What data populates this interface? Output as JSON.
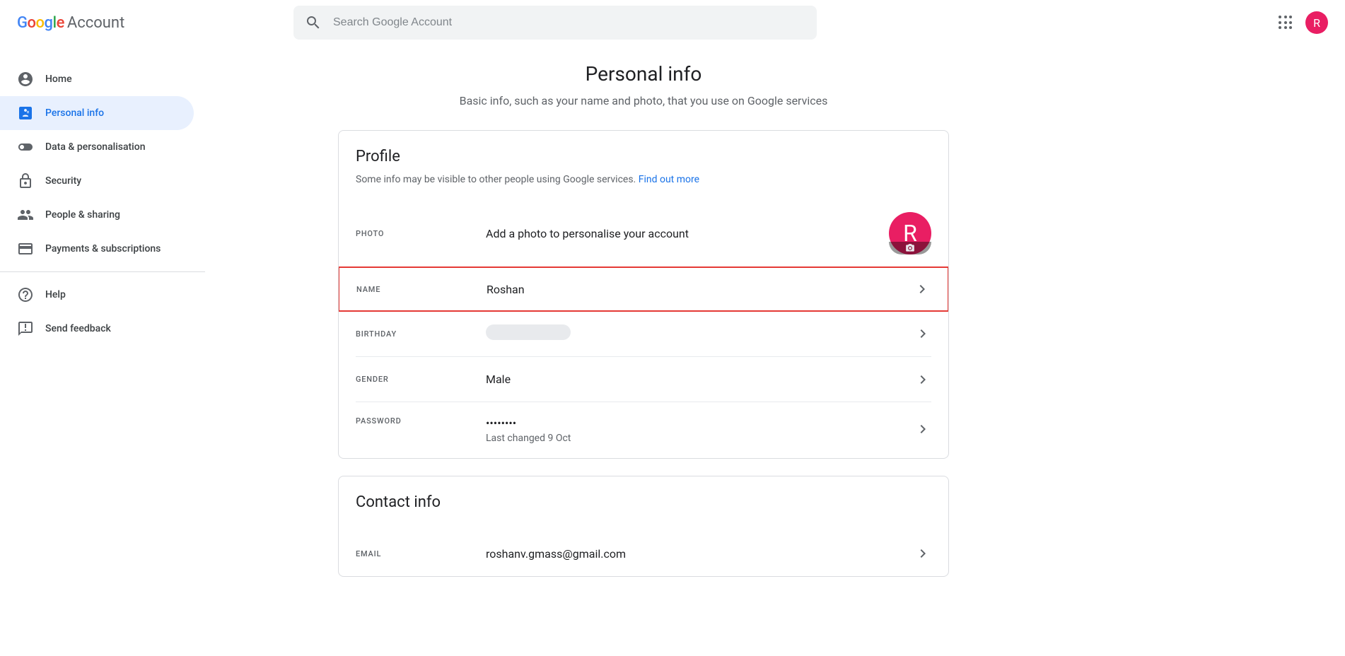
{
  "header": {
    "logo_account": "Account",
    "search_placeholder": "Search Google Account",
    "avatar_letter": "R"
  },
  "sidebar": {
    "items": [
      {
        "label": "Home"
      },
      {
        "label": "Personal info"
      },
      {
        "label": "Data & personalisation"
      },
      {
        "label": "Security"
      },
      {
        "label": "People & sharing"
      },
      {
        "label": "Payments & subscriptions"
      }
    ],
    "footer": [
      {
        "label": "Help"
      },
      {
        "label": "Send feedback"
      }
    ]
  },
  "page": {
    "title": "Personal info",
    "subtitle": "Basic info, such as your name and photo, that you use on Google services"
  },
  "profile": {
    "title": "Profile",
    "subtitle": "Some info may be visible to other people using Google services. ",
    "link": "Find out more",
    "rows": {
      "photo_label": "Photo",
      "photo_desc": "Add a photo to personalise your account",
      "avatar_letter": "R",
      "name_label": "Name",
      "name_value": "Roshan",
      "birthday_label": "Birthday",
      "gender_label": "Gender",
      "gender_value": "Male",
      "password_label": "Password",
      "password_value": "••••••••",
      "password_changed": "Last changed 9 Oct"
    }
  },
  "contact": {
    "title": "Contact info",
    "rows": {
      "email_label": "Email",
      "email_value": "roshanv.gmass@gmail.com"
    }
  }
}
